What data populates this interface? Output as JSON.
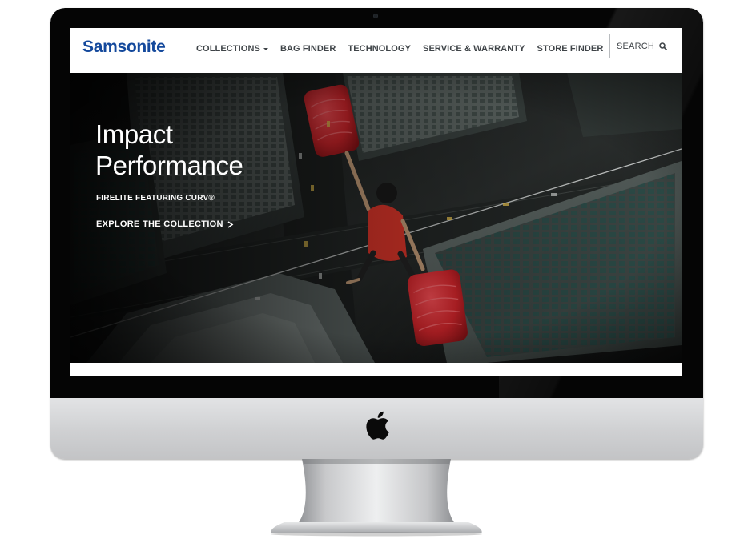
{
  "brand": {
    "logo_text": "Samsonite",
    "logo_color": "#14499c"
  },
  "nav": {
    "items": [
      {
        "label": "COLLECTIONS",
        "has_dropdown": true
      },
      {
        "label": "BAG FINDER"
      },
      {
        "label": "TECHNOLOGY"
      },
      {
        "label": "SERVICE & WARRANTY"
      },
      {
        "label": "STORE FINDER"
      }
    ],
    "search_label": "SEARCH",
    "search_icon": "magnifier-icon"
  },
  "hero": {
    "title_line1": "Impact",
    "title_line2": "Performance",
    "subtitle": "FIRELITE FEATURING CURV®",
    "cta_label": "EXPLORE THE COLLECTION",
    "cta_icon": "chevron-right-icon",
    "image_description_icon": "hero-photo",
    "accent_color": "#d8262c"
  },
  "device": {
    "type": "desktop monitor",
    "logo_icon": "apple-logo-icon"
  }
}
